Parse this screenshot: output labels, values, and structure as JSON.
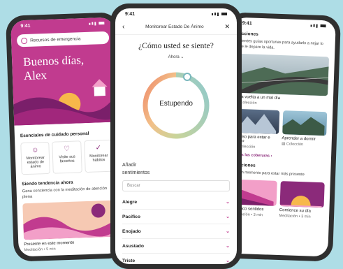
{
  "time": "9:41",
  "left_phone": {
    "emergency_label": "Recursos de emergencia",
    "greeting": "Buenos días, Alex",
    "essentials_title": "Esenciales de cuidado personal",
    "essentials": [
      {
        "icon": "smiley-icon",
        "label": "Monitorear estado de ánimo"
      },
      {
        "icon": "heart-icon",
        "label": "Visite sus favoritos"
      },
      {
        "icon": "check-icon",
        "label": "Monitorear hábitos"
      }
    ],
    "trending_title": "Siendo tendencia ahora",
    "trending_sub": "Gana conciencia con la meditación de atención plena",
    "card_caption": "Presente en este momento",
    "card_meta": "Meditación • 5 min"
  },
  "center_phone": {
    "header_title": "Monitorear Estado De Ánimo",
    "question": "¿Cómo usted se siente?",
    "when": "Ahora",
    "mood": "Estupendo",
    "add_feelings": "Añadir sentimientos",
    "search_placeholder": "Buscar",
    "feelings": [
      "Alegre",
      "Pacífico",
      "Enojado",
      "Asustado",
      "Triste"
    ]
  },
  "right_phone": {
    "collections_title": "lecciones",
    "collections_sub": "guientes guías oportunas para ayudarlo a nejar lo que le depare la vida.",
    "feature_caption": "ar la vuelta a un mal día",
    "feature_meta": "Colección",
    "grid": [
      {
        "caption": "ermiso para estar e duelo",
        "meta": "Colección"
      },
      {
        "caption": "Aprender a dormir",
        "meta": "Colección"
      }
    ],
    "see_all": "todas las coberuras",
    "meditations_title": "ditaciones",
    "meditations_sub": "ate un momento para estar más presente",
    "meds": [
      {
        "caption": "us cinco sentidos",
        "meta": "Meditación • 3 min"
      },
      {
        "caption": "Comience su día",
        "meta": "Meditación • 3 min"
      }
    ]
  },
  "colors": {
    "brand": "#c13b8f",
    "background": "#aedde6",
    "accent_dark": "#8b2a7a"
  }
}
